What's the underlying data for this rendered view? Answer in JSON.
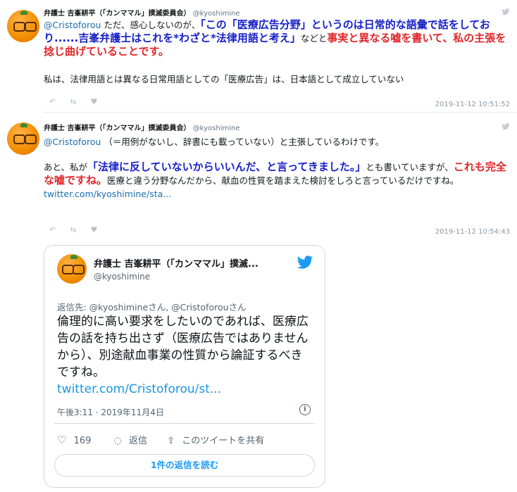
{
  "tweets": [
    {
      "display_name": "弁護士 吉峯耕平（「カンママル」撲滅委員会）",
      "handle": "@kyoshimine",
      "body": {
        "mention": "@Cristoforou",
        "seg1": " ただ、感心しないのが、",
        "blue1": "「この「医療広告分野」というのは日常的な語彙で話をしており......吉峯弁護士はこれを*わざと*法律用語と考え」",
        "seg2": "などと",
        "red1": "事実と異なる嘘を書いて、私の主張を捻じ曲げていることです。",
        "para2": "私は、法律用語とは異なる日常用語としての「医療広告」は、日本語として成立していない"
      },
      "timestamp": "2019-11-12 10:51:52"
    },
    {
      "display_name": "弁護士 吉峯耕平（「カンママル」撲滅委員会）",
      "handle": "@kyoshimine",
      "body": {
        "mention": "@Cristoforou",
        "seg1": " （＝用例がないし、辞書にも載っていない）と主張しているわけです。",
        "seg2": "あと、私が",
        "blue1": "「法律に反していないからいいんだ、と言ってきました。」",
        "seg3": "とも書いていますが、",
        "red1": "これも完全な嘘ですね。",
        "seg4": "医療と違う分野なんだから、献血の性質を踏まえた検討をしろと言っているだけですね。",
        "link": "twitter.com/kyoshimine/sta..."
      },
      "timestamp": "2019-11-12 10:54:43"
    }
  ],
  "embed": {
    "display_name": "弁護士 吉峯耕平（「カンママル」撲滅...",
    "handle": "@kyoshimine",
    "reply_to": "返信先: @kyoshimineさん, @Cristoforouさん",
    "text": "倫理的に高い要求をしたいのであれば、医療広告の話を持ち出さず（医療広告ではありませんから）、別途献血事業の性質から論証するべきですね。",
    "link": "twitter.com/Cristoforou/st...",
    "date": "午後3:11 · 2019年11月4日",
    "like_count": "169",
    "reply_label": "返信",
    "share_label": "このツイートを共有",
    "read_replies": "1件の返信を読む"
  },
  "colors": {
    "blue_emphasis": "#1620c8",
    "red_emphasis": "#e0262a",
    "link": "#1b6fb3"
  }
}
